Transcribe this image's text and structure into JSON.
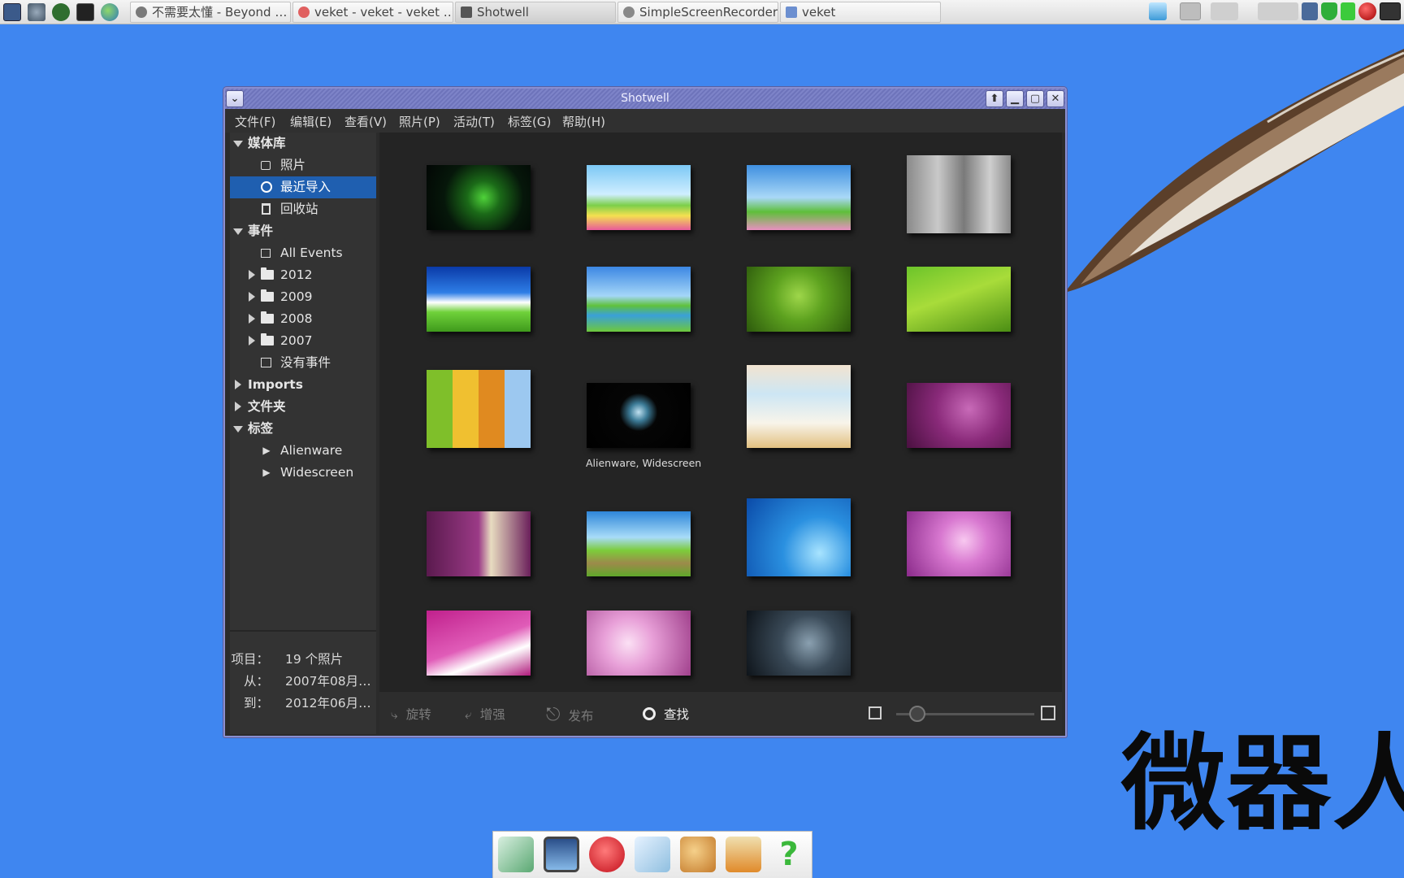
{
  "taskbar": {
    "tasks": [
      {
        "label": "不需要太懂 - Beyond …",
        "color": "#8a8a8a"
      },
      {
        "label": "veket - veket - veket …",
        "color": "#e06060"
      },
      {
        "label": "Shotwell",
        "color": "#555555"
      },
      {
        "label": "SimpleScreenRecorder",
        "color": "#888888"
      },
      {
        "label": "veket",
        "color": "#6c8fd0"
      }
    ],
    "launcher_icons": [
      "system-monitor-icon",
      "settings-icon",
      "media-player-icon",
      "terminal-icon",
      "globe-icon"
    ],
    "tray_icons": [
      "network-monitor-icon",
      "window-icon",
      "blank-icon",
      "blank-icon",
      "network-icon",
      "shield-icon",
      "battery-icon",
      "record-icon",
      "keyboard-icon"
    ]
  },
  "desktop": {
    "big_text": "微器人"
  },
  "window": {
    "title": "Shotwell",
    "buttons": {
      "up": "⬆",
      "minimize": "▁",
      "maximize": "▢",
      "close": "✕",
      "menu": "⌄"
    },
    "menu": [
      "文件(F)",
      "编辑(E)",
      "查看(V)",
      "照片(P)",
      "活动(T)",
      "标签(G)",
      "帮助(H)"
    ],
    "sidebar": {
      "library": {
        "label": "媒体库",
        "items": [
          {
            "label": "照片",
            "icon": "photos-icon"
          },
          {
            "label": "最近导入",
            "icon": "clock-icon",
            "selected": true
          },
          {
            "label": "回收站",
            "icon": "trash-icon"
          }
        ]
      },
      "events": {
        "label": "事件",
        "items": [
          {
            "label": "All Events",
            "icon": "events-icon"
          },
          {
            "label": "2012",
            "icon": "folder-icon"
          },
          {
            "label": "2009",
            "icon": "folder-icon"
          },
          {
            "label": "2008",
            "icon": "folder-icon"
          },
          {
            "label": "2007",
            "icon": "folder-icon"
          },
          {
            "label": "没有事件",
            "icon": "no-event-icon"
          }
        ]
      },
      "imports": {
        "label": "Imports"
      },
      "folders": {
        "label": "文件夹"
      },
      "tags": {
        "label": "标签",
        "items": [
          {
            "label": "Alienware",
            "icon": "tag-icon"
          },
          {
            "label": "Widescreen",
            "icon": "tag-icon"
          }
        ]
      }
    },
    "status": {
      "items_label": "项目：",
      "items_value": "19 个照片",
      "from_label": "从：",
      "from_value": "2007年08月…",
      "to_label": "到：",
      "to_value": "2012年06月…"
    },
    "photos": [
      {
        "bg": "radial-gradient(circle at 55% 50%, #4fd23a 0%, #1b6a18 25%, #06170a 60%, #020604 100%)"
      },
      {
        "bg": "linear-gradient(#7cc8f5 0%, #cfeeff 45%, #7ccf4a 62%, #f4e050 78%, #e85a9a 100%)"
      },
      {
        "bg": "linear-gradient(#3f8fe0 0%, #a9d8f7 50%, #5ebf3a 72%, #e890c0 100%)"
      },
      {
        "bg": "linear-gradient(90deg, #8a8a8a, #c9c9c9 30%, #7a7a7a 55%, #cfcfcf 80%, #8a8a8a)"
      },
      {
        "bg": "linear-gradient(#0a3aa8 0%, #2e7ee6 40%, #ffffff 55%, #6fd13a 70%, #3f9a1c 100%)"
      },
      {
        "bg": "linear-gradient(#3c87e3 0%, #a4d6f8 45%, #5fc13c 60%, #3aa0d8 75%, #6ec83a 100%)"
      },
      {
        "bg": "radial-gradient(circle at 50% 45%, #9ed64a 0%, #5da21f 40%, #2d5a0c 100%)"
      },
      {
        "bg": "linear-gradient(160deg, #6cc42a 0%, #a8dc3a 45%, #4b8e14 100%)"
      },
      {
        "bg": "linear-gradient(90deg, #7fbf2a 0 25%, #f0c030 25% 50%, #e08a20 50% 75%, #9cc8f0 75% 100%)"
      },
      {
        "bg": "radial-gradient(circle at 50% 45%, #bfe0f0 0%, #3d7c98 14%, #050505 30%, #000000 100%)",
        "caption": "Alienware, Widescreen"
      },
      {
        "bg": "linear-gradient(#f2e4d0 0%, #cde6f4 35%, #f8f4ea 70%, #e2c080 100%)"
      },
      {
        "bg": "radial-gradient(circle at 60% 40%, #c86ab8 0%, #8a2a7a 45%, #4a1040 100%)"
      },
      {
        "bg": "linear-gradient(90deg, #5a1a4e 0%, #9b3a86 50%, #e8dcc0 62%, #6a1f5a 100%)"
      },
      {
        "bg": "linear-gradient(#2e86d8 0%, #a8dcf8 40%, #7ccc3a 60%, #9c8a4a 80%, #5fa82a 100%)"
      },
      {
        "bg": "radial-gradient(circle at 70% 70%, #a8e4ff 0%, #2a90e0 40%, #0a4aa8 100%)"
      },
      {
        "bg": "radial-gradient(circle at 55% 45%, #f8c8f0 0%, #d878d0 35%, #8a2a8a 100%)"
      },
      {
        "bg": "linear-gradient(160deg, #c0208c 0%, #e05cb8 50%, #ffffff 70%, #b01a7c 100%)"
      },
      {
        "bg": "radial-gradient(circle at 40% 50%, #fbe0f4 0%, #e8a0d8 35%, #a0408c 100%)"
      },
      {
        "bg": "radial-gradient(circle at 60% 50%, #8aa0b0 0%, #3a4a58 40%, #0e141a 100%)"
      }
    ],
    "toolbar": {
      "rotate": "旋转",
      "enhance": "增强",
      "publish": "发布",
      "find": "查找",
      "zoom": 0.15
    }
  },
  "dock": {
    "items": [
      "file-manager-icon",
      "monitor-icon",
      "mascot-icon",
      "document-icon",
      "paint-icon",
      "veket-icon",
      "help-icon"
    ]
  }
}
